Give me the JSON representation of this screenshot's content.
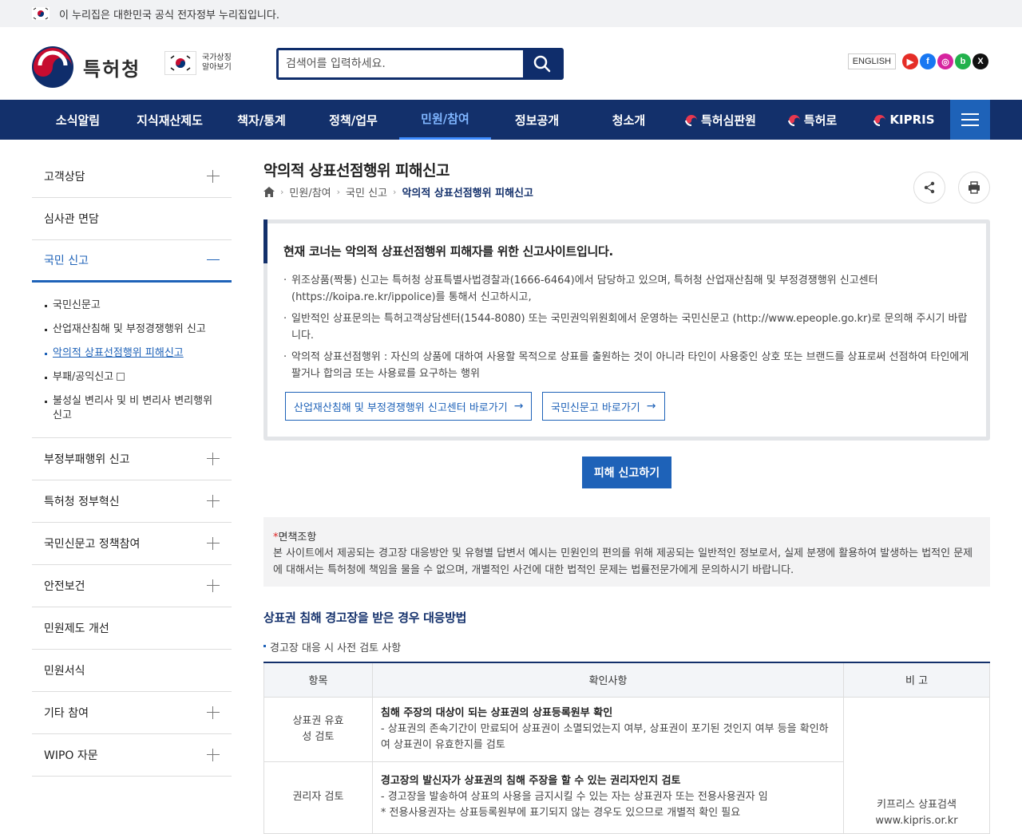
{
  "gov_banner": {
    "text": "이 누리집은 대한민국 공식 전자정부 누리집입니다."
  },
  "header": {
    "logo_text": "특허청",
    "symbol_label": "국가상징 알아보기",
    "search_placeholder": "검색어를 입력하세요.",
    "lang_label": "ENGLISH",
    "sns": [
      "youtube-icon",
      "facebook-icon",
      "instagram-icon",
      "blog-icon",
      "x-icon"
    ]
  },
  "gnb": {
    "items": [
      {
        "label": "소식알림"
      },
      {
        "label": "지식재산제도"
      },
      {
        "label": "책자/통계"
      },
      {
        "label": "정책/업무"
      },
      {
        "label": "민원/참여",
        "active": true
      },
      {
        "label": "정보공개"
      },
      {
        "label": "청소개"
      },
      {
        "label": "특허심판원"
      },
      {
        "label": "특허로"
      },
      {
        "label": "KIPRIS"
      }
    ]
  },
  "sidebar": {
    "items": [
      {
        "label": "고객상담"
      },
      {
        "label": "심사관 면담"
      },
      {
        "label": "국민 신고"
      },
      {
        "label": "부정부패행위 신고"
      },
      {
        "label": "특허청 정부혁신"
      },
      {
        "label": "국민신문고 정책참여"
      },
      {
        "label": "안전보건"
      },
      {
        "label": "민원제도 개선"
      },
      {
        "label": "민원서식"
      },
      {
        "label": "기타 참여"
      },
      {
        "label": "WIPO 자문"
      }
    ],
    "sub_items": [
      {
        "label": "국민신문고"
      },
      {
        "label": "산업재산침해 및 부정경쟁행위 신고"
      },
      {
        "label": "악의적 상표선점행위 피해신고"
      },
      {
        "label": "부패/공익신고"
      },
      {
        "label": "불성실 변리사 및 비 변리사 변리행위 신고"
      }
    ]
  },
  "page": {
    "title": "악의적 상표선점행위 피해신고",
    "breadcrumb": [
      "민원/참여",
      "국민 신고",
      "악의적 상표선점행위 피해신고"
    ]
  },
  "notice": {
    "heading": "현재 코너는 악의적 상표선점행위 피해자를 위한 신고사이트입니다.",
    "paragraphs": [
      "위조상품(짝퉁) 신고는 특허청 상표특별사법경찰과(1666-6464)에서 담당하고 있으며, 특허청 산업재산침해 및 부정경쟁행위 신고센터(https://koipa.re.kr/ippolice)를 통해서 신고하시고,",
      "일반적인 상표문의는 특허고객상담센터(1544-8080) 또는 국민권익위원회에서 운영하는 국민신문고 (http://www.epeople.go.kr)로 문의해 주시기 바랍니다.",
      "악의적 상표선점행위 : 자신의 상품에 대하여 사용할 목적으로 상표를 출원하는 것이 아니라 타인이 사용중인 상호 또는 브랜드를 상표로써 선점하여 타인에게 팔거나 합의금 또는 사용료를 요구하는 행위"
    ],
    "button1": "산업재산침해 및 부정경쟁행위 신고센터 바로가기",
    "button2": "국민신문고 바로가기"
  },
  "report_button": "피해 신고하기",
  "disclaimer": {
    "title": "면책조항",
    "body": "본 사이트에서 제공되는 경고장 대응방안 및 유형별 답변서 예시는 민원인의 편의를 위해 제공되는 일반적인 정보로서, 실제 분쟁에 활용하여 발생하는 법적인 문제에 대해서는 특허청에 책임을 물을 수 없으며, 개별적인 사건에 대한 법적인 문제는 법률전문가에게 문의하시기 바랍니다."
  },
  "section": {
    "title": "상표권 침해 경고장을 받은 경우 대응방법",
    "subtitle": "경고장 대응 시 사전 검토 사항"
  },
  "table": {
    "headers": [
      "항목",
      "확인사항",
      "비 고"
    ],
    "rows": [
      {
        "item": "상표권 유효성 검토",
        "check_title": "침해 주장의 대상이 되는 상표권의 상표등록원부 확인",
        "check_body": "- 상표권의 존속기간이 만료되어 상표권이 소멸되었는지 여부, 상표권이 포기된 것인지 여부 등을 확인하여 상표권이 유효한지를 검토"
      },
      {
        "item": "권리자 검토",
        "check_title": "경고장의 발신자가 상표권의 침해 주장을 할 수 있는 권리자인지 검토",
        "check_body": "- 경고장을 발송하여 상표의 사용을 금지시킬 수 있는 자는 상표권자 또는 전용사용권자 임",
        "check_body2": "* 전용사용권자는 상표등록원부에 표기되지 않는 경우도 있으므로 개별적 확인 필요"
      }
    ],
    "remark": "키프리스 상표검색 www.kipris.or.kr"
  }
}
